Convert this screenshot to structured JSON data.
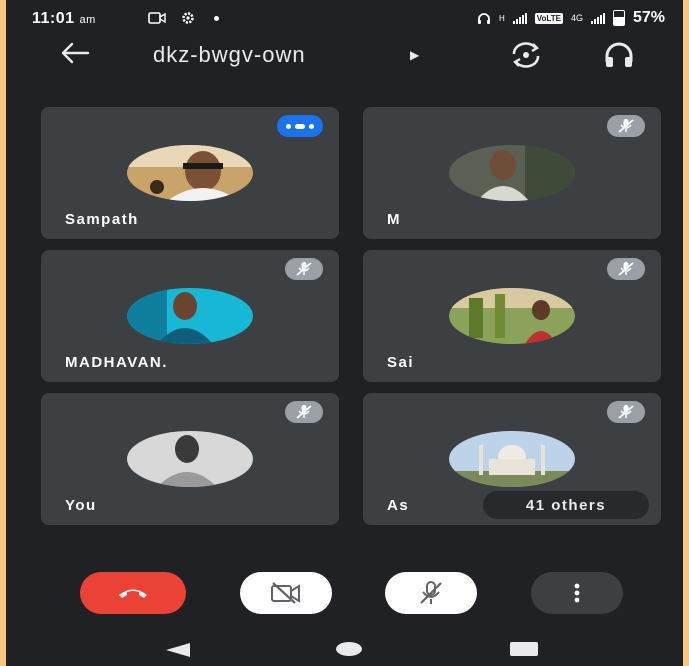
{
  "status_bar": {
    "time": "11:01",
    "ampm": "am",
    "network_small": "H",
    "volte": "VoLTE",
    "lte": "4G",
    "battery": "57%"
  },
  "header": {
    "meeting_code": "dkz-bwgv-own",
    "icons": {
      "back": "arrow-left-icon",
      "switch_camera": "switch-camera-icon",
      "audio_output": "headphones-icon"
    }
  },
  "participants": [
    {
      "name": "Sampath",
      "status": "speaking"
    },
    {
      "name": "M",
      "status": "muted"
    },
    {
      "name": "MADHAVAN.",
      "status": "muted"
    },
    {
      "name": "Sai",
      "status": "muted"
    },
    {
      "name": "You",
      "status": "muted"
    },
    {
      "name": "As",
      "status": "muted",
      "others_label": "41 others"
    }
  ],
  "controls": {
    "hangup": "hang-up-icon",
    "camera": "camera-off-icon",
    "mic": "mic-off-icon",
    "more": "more-vert-icon"
  },
  "colors": {
    "background": "#202124",
    "tile": "#3c4043",
    "speaking": "#1a73e8",
    "hangup": "#ea4335",
    "page_border": "#f3c77f"
  }
}
